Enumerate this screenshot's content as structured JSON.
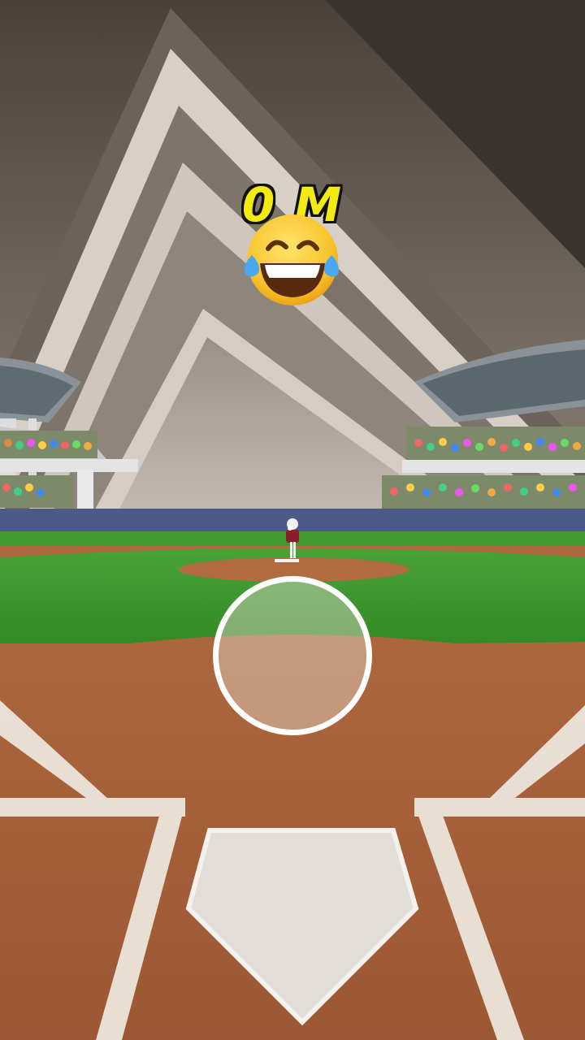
{
  "hud": {
    "distance_label": "0 M",
    "reaction_emoji": "face-with-tears-of-joy"
  },
  "colors": {
    "distance_text": "#f3ea12",
    "grass": "#3f9b2e",
    "dirt": "#a8623a",
    "wall": "#4c5a8a",
    "chalk": "#efe9e0"
  }
}
